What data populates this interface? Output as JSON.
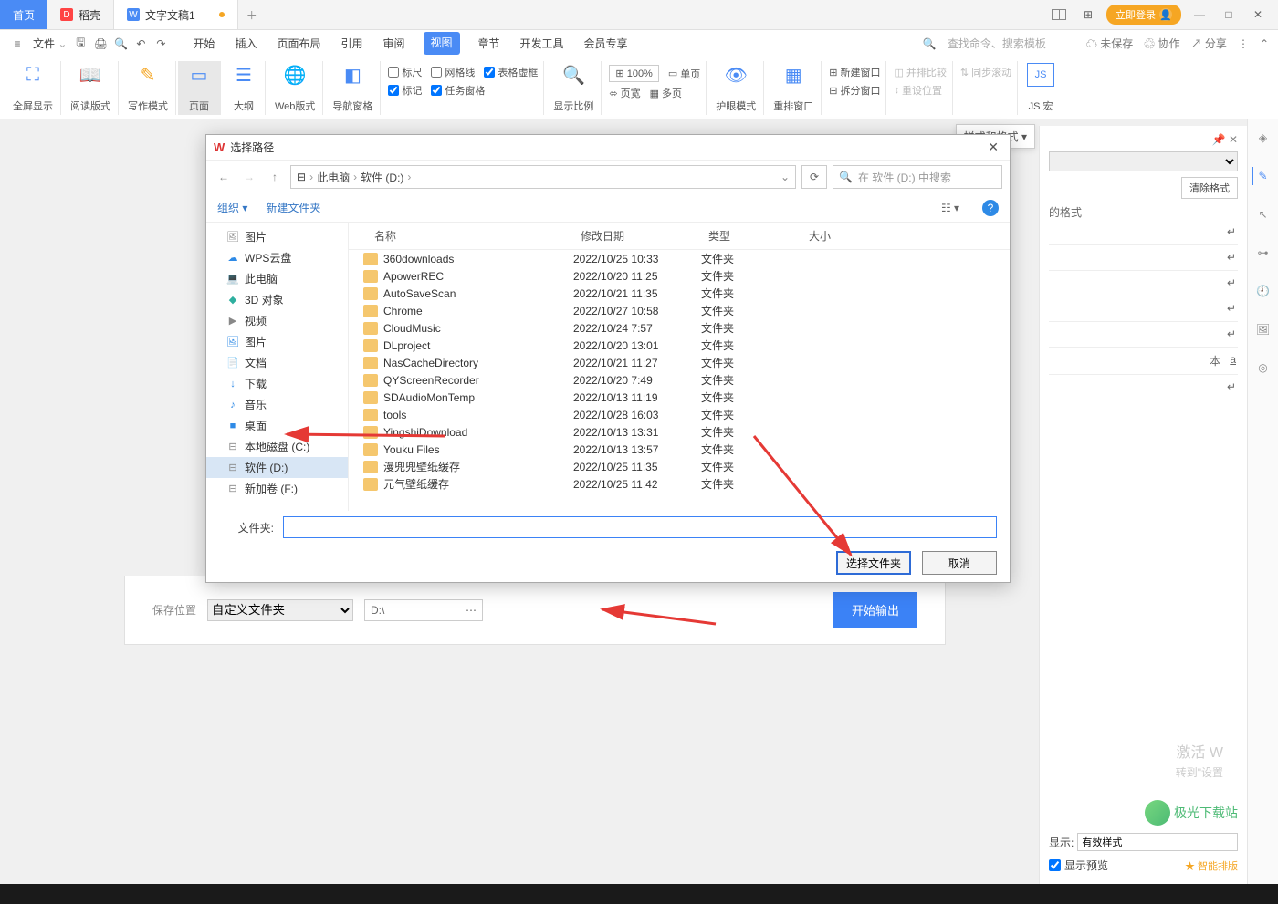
{
  "tabs": {
    "home": "首页",
    "shell": "稻壳",
    "doc": "文字文稿1"
  },
  "login": "立即登录",
  "menu": {
    "file": "文件",
    "items": [
      "开始",
      "插入",
      "页面布局",
      "引用",
      "审阅",
      "视图",
      "章节",
      "开发工具",
      "会员专享"
    ],
    "active_index": 5,
    "search_hint": "查找命令、搜索模板",
    "unsaved": "未保存",
    "coop": "协作",
    "share": "分享"
  },
  "ribbon": {
    "fullscreen": "全屏显示",
    "read": "阅读版式",
    "write": "写作模式",
    "page": "页面",
    "outline": "大纲",
    "web": "Web版式",
    "navpane": "导航窗格",
    "ruler": "标尺",
    "grid": "网格线",
    "tablevirt": "表格虚框",
    "marks": "标记",
    "taskpane": "任务窗格",
    "zoomratio": "显示比例",
    "zoom_val": "100%",
    "onepage": "单页",
    "pagew": "页宽",
    "multipage": "多页",
    "eyecare": "护眼模式",
    "rearrange": "重排窗口",
    "newwin": "新建窗口",
    "splitwin": "拆分窗口",
    "sidebyside": "并排比较",
    "syncscroll": "同步滚动",
    "resetpos": "重设位置",
    "jsmacro": "JS 宏"
  },
  "styles_drop": "样式和格式",
  "right_panel": {
    "clear": "清除格式",
    "applied": "的格式",
    "show_label": "显示:",
    "show_value": "有效样式",
    "preview": "显示预览",
    "smart": "智能排版",
    "rows": [
      "↵",
      "↵",
      "↵",
      "↵",
      "↵",
      "↵"
    ],
    "special1": "本",
    "special2": "a"
  },
  "export": {
    "label": "保存位置",
    "select": "自定义文件夹",
    "path": "D:\\",
    "go": "开始输出"
  },
  "dialog": {
    "title": "选择路径",
    "breadcrumb": [
      "此电脑",
      "软件 (D:)"
    ],
    "search_ph": "在 软件 (D:) 中搜索",
    "organize": "组织",
    "newfolder": "新建文件夹",
    "cols": {
      "name": "名称",
      "date": "修改日期",
      "type": "类型",
      "size": "大小"
    },
    "tree": [
      {
        "icon": "🖼",
        "label": "图片"
      },
      {
        "icon": "☁",
        "label": "WPS云盘",
        "color": "#2e8ae6"
      },
      {
        "icon": "💻",
        "label": "此电脑",
        "color": "#2e8ae6"
      },
      {
        "icon": "◆",
        "label": "3D 对象",
        "color": "#2eaf9f"
      },
      {
        "icon": "▶",
        "label": "视频"
      },
      {
        "icon": "🖼",
        "label": "图片",
        "color": "#2e8ae6"
      },
      {
        "icon": "📄",
        "label": "文档"
      },
      {
        "icon": "↓",
        "label": "下载",
        "color": "#2e8ae6"
      },
      {
        "icon": "♪",
        "label": "音乐",
        "color": "#2e8ae6"
      },
      {
        "icon": "■",
        "label": "桌面",
        "color": "#2e8ae6"
      },
      {
        "icon": "⊟",
        "label": "本地磁盘 (C:)"
      },
      {
        "icon": "⊟",
        "label": "软件 (D:)",
        "sel": true
      },
      {
        "icon": "⊟",
        "label": "新加卷 (F:)"
      }
    ],
    "files": [
      {
        "name": "360downloads",
        "date": "2022/10/25 10:33",
        "type": "文件夹"
      },
      {
        "name": "ApowerREC",
        "date": "2022/10/20 11:25",
        "type": "文件夹"
      },
      {
        "name": "AutoSaveScan",
        "date": "2022/10/21 11:35",
        "type": "文件夹"
      },
      {
        "name": "Chrome",
        "date": "2022/10/27 10:58",
        "type": "文件夹"
      },
      {
        "name": "CloudMusic",
        "date": "2022/10/24 7:57",
        "type": "文件夹"
      },
      {
        "name": "DLproject",
        "date": "2022/10/20 13:01",
        "type": "文件夹"
      },
      {
        "name": "NasCacheDirectory",
        "date": "2022/10/21 11:27",
        "type": "文件夹"
      },
      {
        "name": "QYScreenRecorder",
        "date": "2022/10/20 7:49",
        "type": "文件夹"
      },
      {
        "name": "SDAudioMonTemp",
        "date": "2022/10/13 11:19",
        "type": "文件夹"
      },
      {
        "name": "tools",
        "date": "2022/10/28 16:03",
        "type": "文件夹"
      },
      {
        "name": "YingshiDownload",
        "date": "2022/10/13 13:31",
        "type": "文件夹"
      },
      {
        "name": "Youku Files",
        "date": "2022/10/13 13:57",
        "type": "文件夹"
      },
      {
        "name": "漫兜兜壁纸缓存",
        "date": "2022/10/25 11:35",
        "type": "文件夹"
      },
      {
        "name": "元气壁纸缓存",
        "date": "2022/10/25 11:42",
        "type": "文件夹"
      }
    ],
    "folder_label": "文件夹:",
    "ok": "选择文件夹",
    "cancel": "取消"
  },
  "watermark": {
    "l1": "激活 W",
    "l2": "转到\"设置"
  },
  "logo": "极光下载站"
}
